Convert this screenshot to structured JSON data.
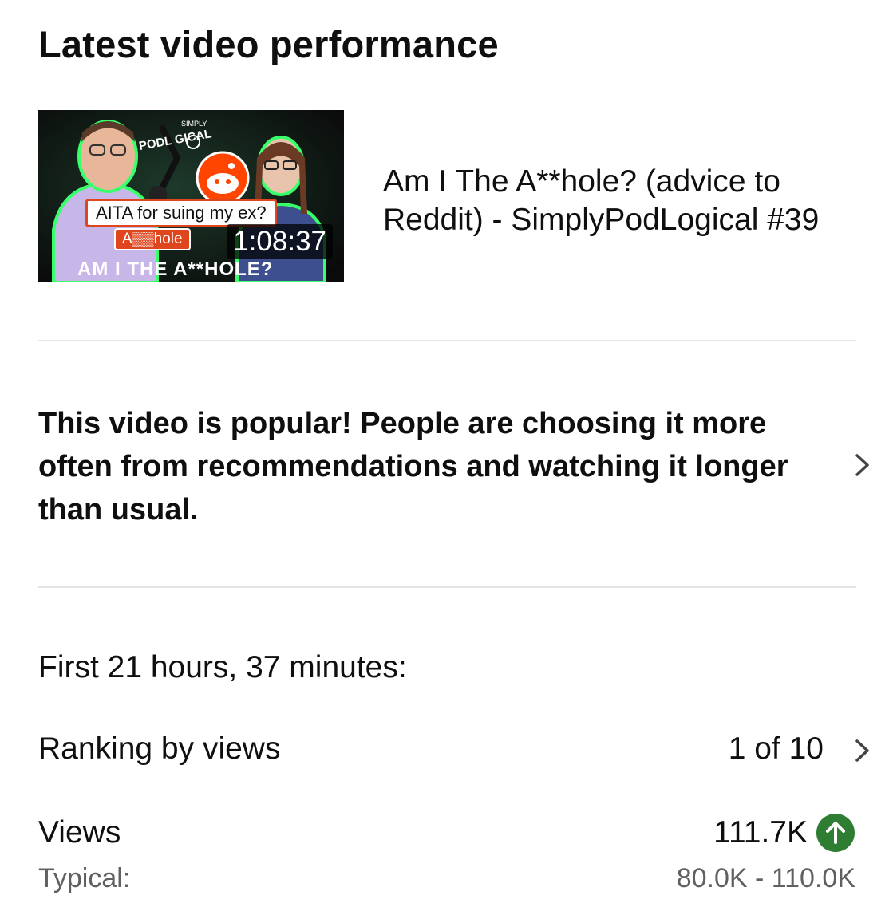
{
  "header": {
    "title": "Latest video performance"
  },
  "video": {
    "title": "Am I The A**hole? (advice to Reddit) - SimplyPodLogical #39",
    "duration": "1:08:37",
    "thumbnail": {
      "logo_text": "PODL  GICAL",
      "logo_small": "SIMPLY",
      "question": "AITA for suing my ex?",
      "tag": "A▒▒hole",
      "banner": "AM I THE A**HOLE?"
    }
  },
  "insight": {
    "text": "This video is popular! People are choosing it more often from recommendations and watching it longer than usual.",
    "icon": "chevron-right-icon"
  },
  "stats": {
    "period": "First 21 hours, 37 minutes:",
    "ranking": {
      "label": "Ranking by views",
      "value": "1 of 10",
      "icon": "chevron-right-icon"
    },
    "views": {
      "label": "Views",
      "value": "111.7K",
      "trend_icon": "arrow-up-icon",
      "trend_color": "#2e7d32"
    },
    "typical": {
      "label": "Typical:",
      "value": "80.0K - 110.0K"
    }
  },
  "colors": {
    "reddit_orange": "#ff4500",
    "accent_green": "#2e7d32",
    "divider": "#e5e5e5",
    "secondary_text": "#606060"
  }
}
